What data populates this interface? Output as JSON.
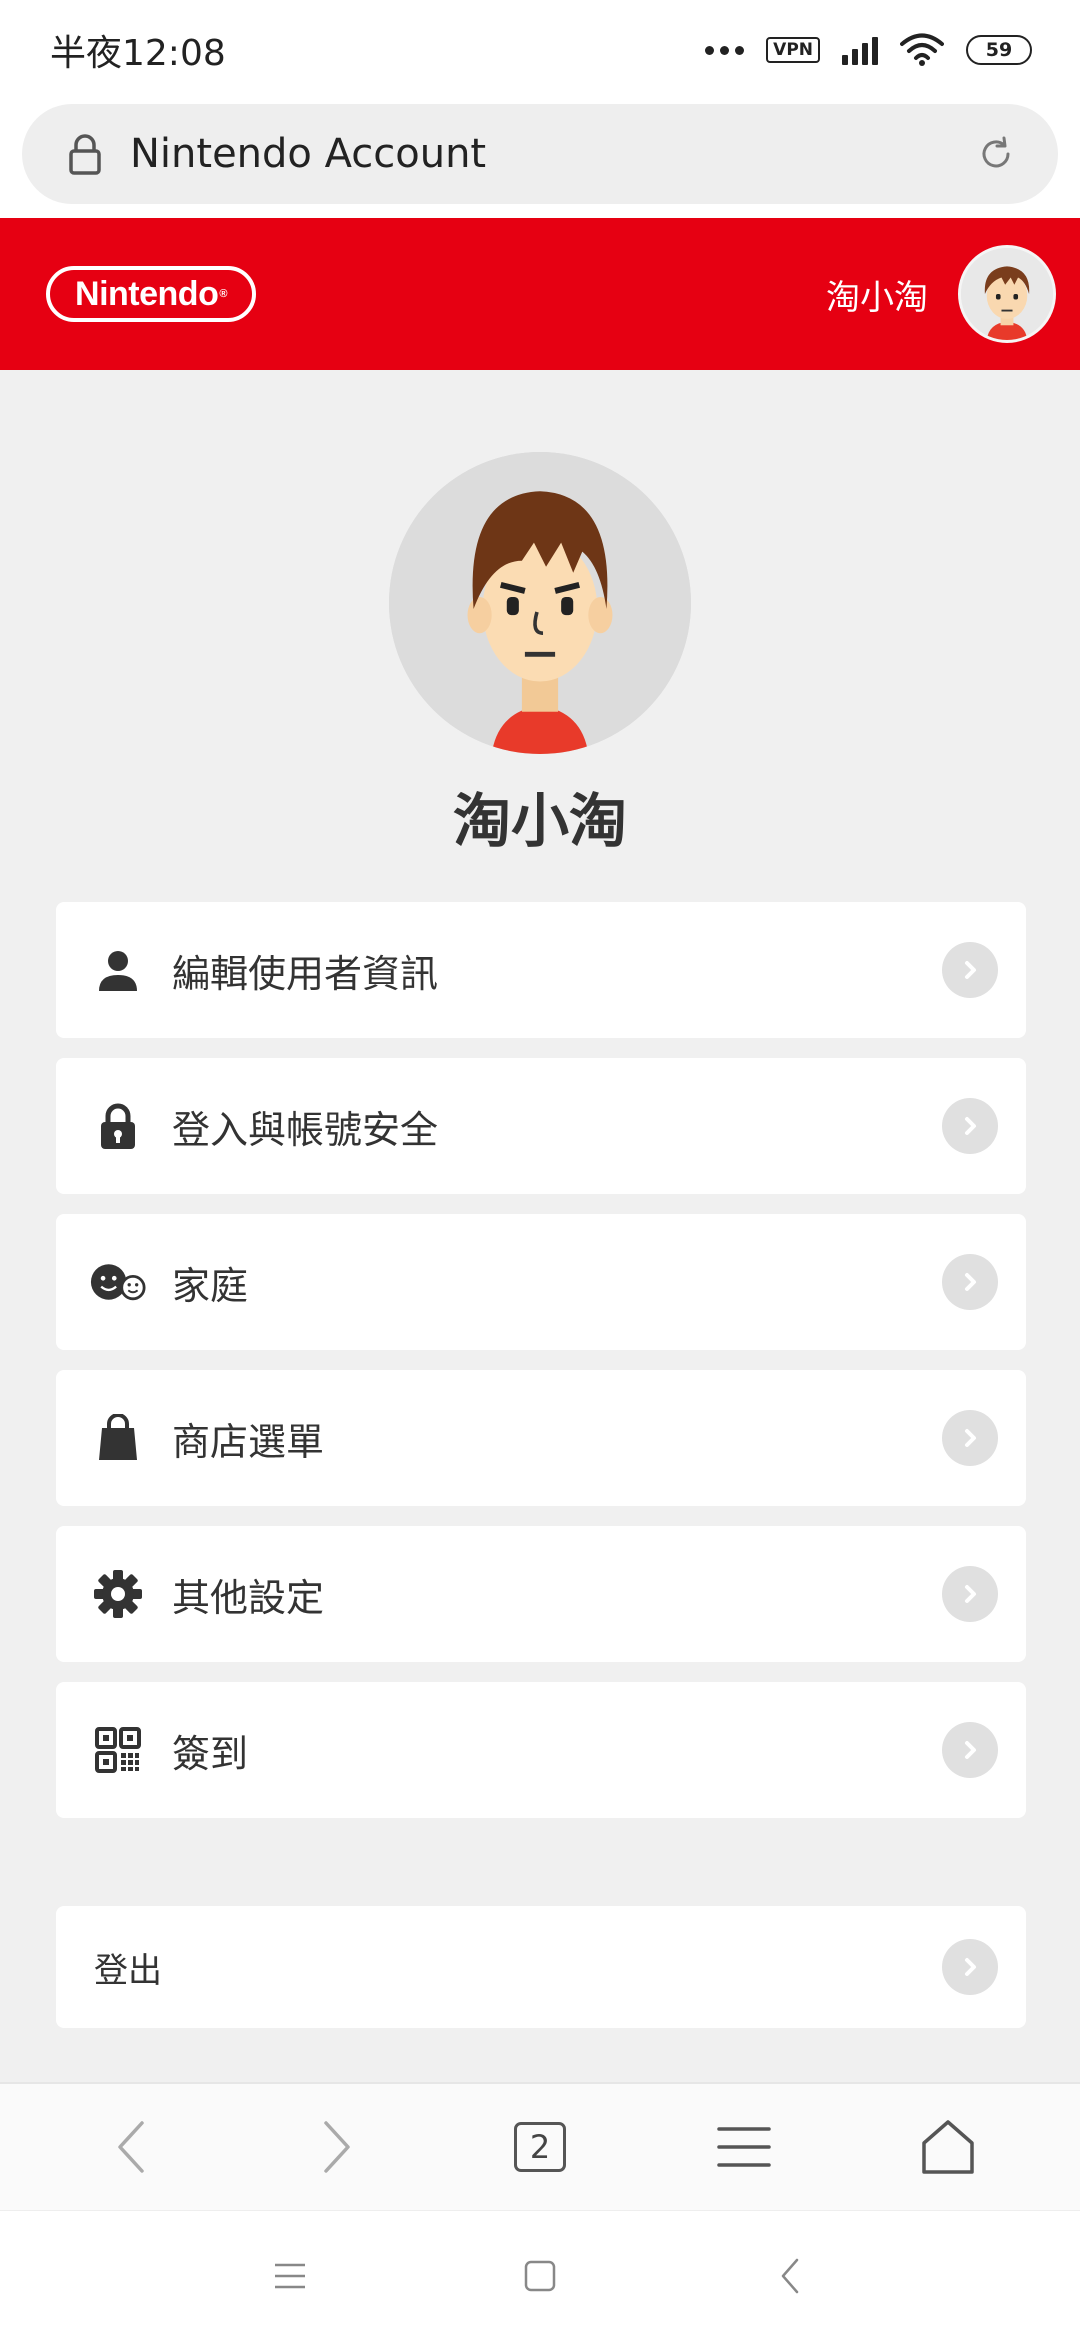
{
  "status_bar": {
    "time": "半夜12:08",
    "vpn": "VPN",
    "battery": "59"
  },
  "url_bar": {
    "title": "Nintendo Account"
  },
  "header": {
    "logo_text": "Nintendo",
    "logo_mark": "®",
    "username": "淘小淘",
    "brand_color": "#e60012"
  },
  "profile": {
    "name": "淘小淘"
  },
  "menu": {
    "items": [
      {
        "label": "編輯使用者資訊",
        "icon": "person-icon"
      },
      {
        "label": "登入與帳號安全",
        "icon": "lock-icon"
      },
      {
        "label": "家庭",
        "icon": "family-faces-icon"
      },
      {
        "label": "商店選單",
        "icon": "shopping-bag-icon"
      },
      {
        "label": "其他設定",
        "icon": "gear-icon"
      },
      {
        "label": "簽到",
        "icon": "qr-code-icon"
      }
    ],
    "logout_label": "登出"
  },
  "browser_bar": {
    "tab_count": "2"
  }
}
